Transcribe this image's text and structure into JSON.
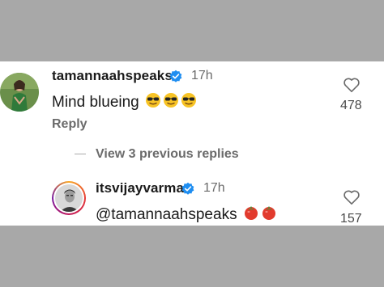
{
  "comments": [
    {
      "username": "tamannaahspeaks",
      "time": "17h",
      "text": "Mind blueing",
      "emojis": [
        "sunglasses-emoji",
        "sunglasses-emoji",
        "sunglasses-emoji"
      ],
      "reply_label": "Reply",
      "likes": "478"
    },
    {
      "username": "itsvijayvarma",
      "time": "17h",
      "text": "@tamannaahspeaks",
      "emojis": [
        "tomato-emoji",
        "tomato-emoji"
      ],
      "likes": "157"
    }
  ],
  "view_replies_label": "View 3 previous replies",
  "colors": {
    "verified_blue": "#1f8ef1",
    "text_primary": "#1a1a1a",
    "text_secondary": "#6b6b6b",
    "backdrop": "#a8a8a8"
  }
}
